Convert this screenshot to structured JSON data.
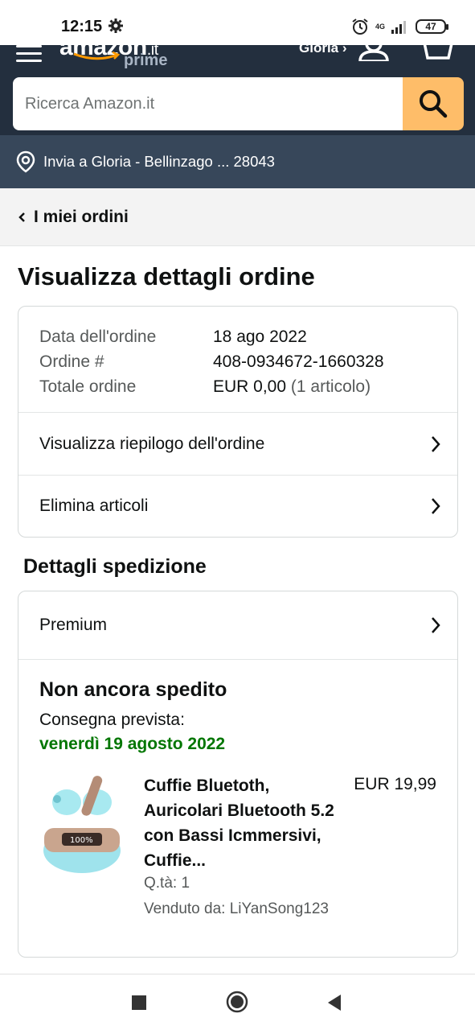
{
  "status_bar": {
    "time": "12:15",
    "network": "4G",
    "battery": "47"
  },
  "header": {
    "logo_text": "amazon",
    "logo_domain": ".it",
    "logo_sub": "prime",
    "greeting": "Gloria ›",
    "search_placeholder": "Ricerca Amazon.it",
    "deliver_to": "Invia a Gloria - Bellinzago ... 28043",
    "brand_color": "#232f3e",
    "search_button_color": "#febd69"
  },
  "breadcrumb": {
    "label": "I miei ordini"
  },
  "page_title": "Visualizza dettagli ordine",
  "order_info": {
    "rows": [
      {
        "key": "Data dell'ordine",
        "value": "18 ago 2022"
      },
      {
        "key": "Ordine #",
        "value": "408-0934672-1660328"
      },
      {
        "key": "Totale ordine",
        "value": "EUR 0,00",
        "extra": "(1 articolo)"
      }
    ],
    "summary_link": "Visualizza riepilogo dell'ordine",
    "delete_link": "Elimina articoli"
  },
  "shipping": {
    "section_title": "Dettagli spedizione",
    "method": "Premium",
    "status": "Non ancora spedito",
    "delivery_label": "Consegna prevista:",
    "delivery_date": "venerdì 19 agosto 2022",
    "product": {
      "title": "Cuffie Bluetoth, Auricolari Bluetooth 5.2 con Bassi Icmmersivi, Cuffie...",
      "price": "EUR 19,99",
      "quantity": "Q.tà: 1",
      "seller": "Venduto da: LiYanSong123"
    }
  }
}
